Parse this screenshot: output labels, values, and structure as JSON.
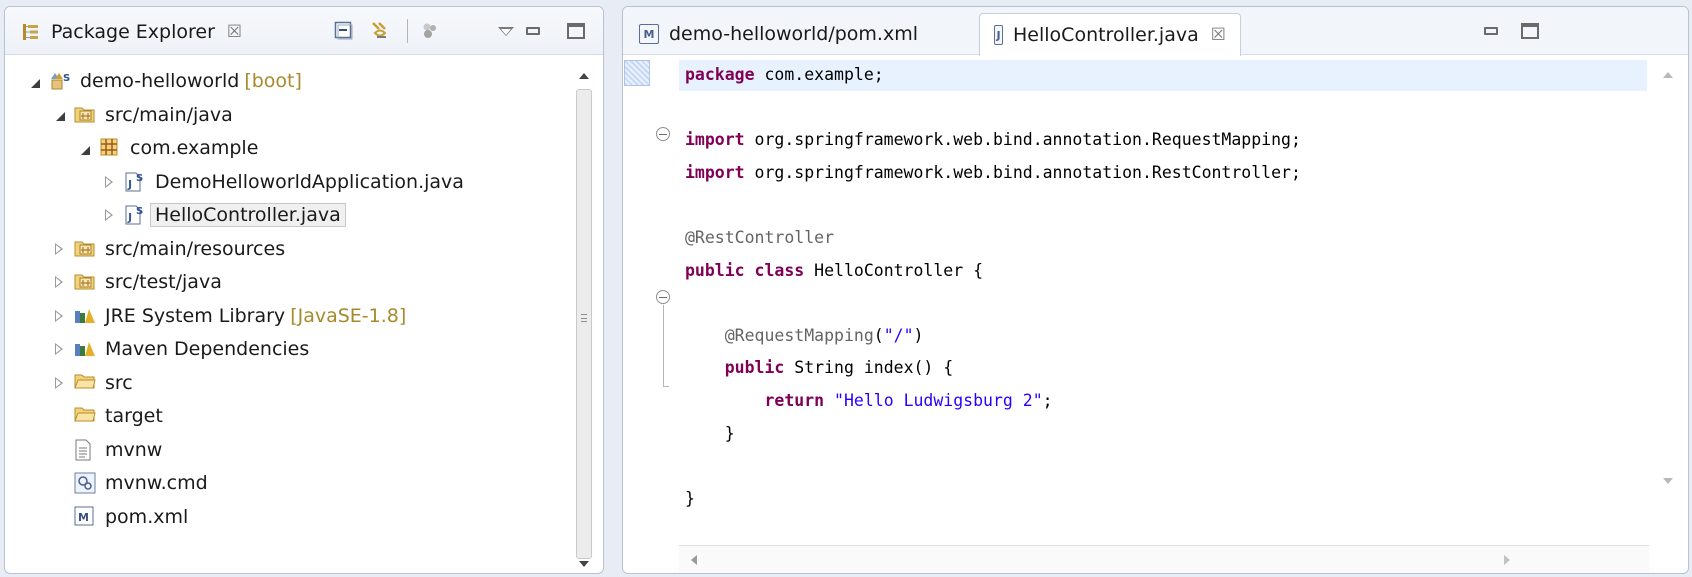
{
  "package_explorer": {
    "title": "Package Explorer",
    "close_glyph": "☒",
    "toolbar_icons": [
      "collapse-all-icon",
      "link-with-editor-icon",
      "focus-icon",
      "view-menu-icon"
    ],
    "tree": [
      {
        "label": "demo-helloworld",
        "decoration": "[boot]",
        "icon": "spring-project-icon",
        "expanded": true,
        "indent": 0
      },
      {
        "label": "src/main/java",
        "icon": "source-folder-icon",
        "expanded": true,
        "indent": 1
      },
      {
        "label": "com.example",
        "icon": "package-icon",
        "expanded": true,
        "indent": 2
      },
      {
        "label": "DemoHelloworldApplication.java",
        "icon": "spring-java-file-icon",
        "expanded": false,
        "indent": 3
      },
      {
        "label": "HelloController.java",
        "icon": "spring-java-file-icon",
        "expanded": false,
        "indent": 3,
        "selected": true
      },
      {
        "label": "src/main/resources",
        "icon": "source-folder-icon",
        "expanded": false,
        "indent": 1
      },
      {
        "label": "src/test/java",
        "icon": "source-folder-icon",
        "expanded": false,
        "indent": 1
      },
      {
        "label": "JRE System Library",
        "decoration": "[JavaSE-1.8]",
        "icon": "library-icon",
        "expanded": false,
        "indent": 1
      },
      {
        "label": "Maven Dependencies",
        "icon": "library-icon",
        "expanded": false,
        "indent": 1
      },
      {
        "label": "src",
        "icon": "folder-icon",
        "expanded": false,
        "indent": 1
      },
      {
        "label": "target",
        "icon": "folder-icon",
        "indent": 1
      },
      {
        "label": "mvnw",
        "icon": "text-file-icon",
        "indent": 1
      },
      {
        "label": "mvnw.cmd",
        "icon": "cmd-file-icon",
        "indent": 1
      },
      {
        "label": "pom.xml",
        "icon": "maven-file-icon",
        "indent": 1
      }
    ]
  },
  "editor": {
    "tabs": [
      {
        "label": "demo-helloworld/pom.xml",
        "icon": "maven-file-icon",
        "active": false
      },
      {
        "label": "HelloController.java",
        "icon": "java-file-icon",
        "active": true,
        "close_glyph": "☒"
      }
    ],
    "code_lines": [
      [
        {
          "t": "package",
          "c": "kw"
        },
        {
          "t": " com.example;"
        }
      ],
      [],
      [
        {
          "t": "import",
          "c": "kw"
        },
        {
          "t": " org.springframework.web.bind.annotation.RequestMapping;"
        }
      ],
      [
        {
          "t": "import",
          "c": "kw"
        },
        {
          "t": " org.springframework.web.bind.annotation.RestController;"
        }
      ],
      [],
      [
        {
          "t": "@RestController",
          "c": "ann"
        }
      ],
      [
        {
          "t": "public",
          "c": "kw"
        },
        {
          "t": " "
        },
        {
          "t": "class",
          "c": "kw"
        },
        {
          "t": " HelloController {"
        }
      ],
      [],
      [
        {
          "t": "    "
        },
        {
          "t": "@RequestMapping",
          "c": "ann"
        },
        {
          "t": "("
        },
        {
          "t": "\"/\"",
          "c": "str"
        },
        {
          "t": ")"
        }
      ],
      [
        {
          "t": "    "
        },
        {
          "t": "public",
          "c": "kw"
        },
        {
          "t": " String index() {"
        }
      ],
      [
        {
          "t": "        "
        },
        {
          "t": "return",
          "c": "kw"
        },
        {
          "t": " "
        },
        {
          "t": "\"Hello Ludwigsburg 2\"",
          "c": "str"
        },
        {
          "t": ";"
        }
      ],
      [
        {
          "t": "    }"
        }
      ],
      [],
      [
        {
          "t": "}"
        }
      ]
    ]
  }
}
